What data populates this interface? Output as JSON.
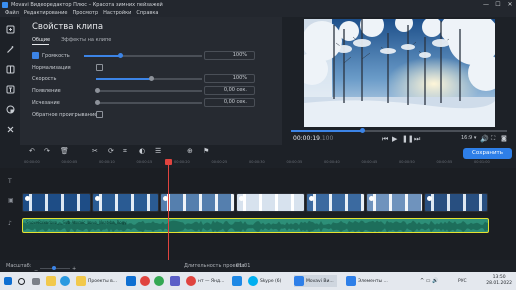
{
  "window": {
    "title": "Movavi Видеоредактор Плюс – Красота зимних пейзажей",
    "min": "—",
    "max": "☐",
    "close": "✕"
  },
  "menu": [
    "Файл",
    "Редактирование",
    "Просмотр",
    "Настройки",
    "Справка"
  ],
  "left_tools": [
    "import-icon",
    "magic-wand-icon",
    "filters-icon",
    "titles-icon",
    "stickers-icon",
    "more-tools-icon"
  ],
  "clip_properties": {
    "title": "Свойства клипа",
    "tabs": [
      "Общие",
      "Эффекты на клипе"
    ],
    "rows": [
      {
        "label": "Громкость",
        "checkbox": true,
        "checked": true,
        "slider": 0.52,
        "value": "100%"
      },
      {
        "label": "Нормализация",
        "checkbox": true,
        "checked": false
      },
      {
        "label": "Скорость",
        "slider": 0.52,
        "value": "100%"
      },
      {
        "label": "Появление",
        "slider": 0.0,
        "value": "0,00 сек."
      },
      {
        "label": "Исчезание",
        "slider": 0.0,
        "value": "0,00 сек."
      },
      {
        "label": "Обратное проигрывание",
        "checkbox": true,
        "checked": false
      }
    ]
  },
  "preview": {
    "timecode": "00:00:19",
    "timecode_ms": ".100",
    "progress": 0.33,
    "aspect": "16:9"
  },
  "toolbar": {
    "save_label": "Сохранить"
  },
  "ruler": [
    "00:00:00",
    "00:00:05",
    "00:00:10",
    "00:00:15",
    "00:00:20",
    "00:00:25",
    "00:00:30",
    "00:00:35",
    "00:00:40",
    "00:00:45",
    "00:00:50",
    "00:00:55",
    "00:01:00"
  ],
  "audio_track": {
    "label": "Snow-Rakadoro_-_Sub-Atomic_Love_(feat-ba_Rogy..."
  },
  "status": {
    "scale_label": "Масштаб:",
    "scale_value": 0.45,
    "duration_label": "Длительность проекта:",
    "duration_value": "01:01"
  },
  "taskbar": {
    "items": [
      "Проекты в...",
      "нт — Янд...",
      "Skype (6)",
      "Movavi Ви...",
      "Элементы ..."
    ],
    "lang": "РУС",
    "time": "13:50",
    "date": "28.01.2022"
  },
  "colors": {
    "accent": "#2e7fe8",
    "playhead": "#e0443f",
    "audio": "#2d8f78",
    "audio_border": "#e4e230"
  }
}
